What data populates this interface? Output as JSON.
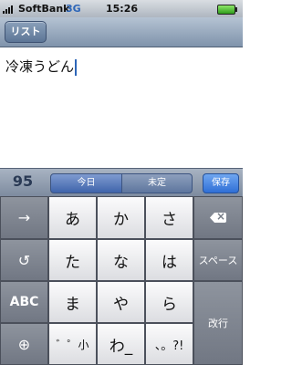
{
  "status": {
    "carrier": "SoftBank",
    "network": "3G",
    "time": "15:26"
  },
  "nav": {
    "back_label": "リスト"
  },
  "note": {
    "text": "冷凍うどん"
  },
  "candidate_bar": {
    "count": "95",
    "seg_today": "今日",
    "seg_undecided": "未定",
    "save_label": "保存"
  },
  "keyboard": {
    "row1": [
      "あ",
      "か",
      "さ"
    ],
    "row2": [
      "た",
      "な",
      "は"
    ],
    "row3": [
      "ま",
      "や",
      "ら"
    ],
    "row4": [
      "゛゜小",
      "わ_",
      "、。?!"
    ],
    "left": {
      "arrow": "→",
      "undo": "↺",
      "abc": "ABC",
      "globe": "⊕"
    },
    "space_label": "スペース",
    "return_label": "改行"
  }
}
